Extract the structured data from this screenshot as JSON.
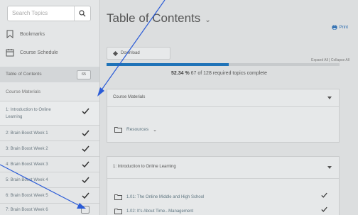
{
  "sidebar": {
    "search_placeholder": "Search Topics",
    "bookmarks": "Bookmarks",
    "course_schedule": "Course Schedule",
    "toc_label": "Table of Contents",
    "toc_count": "65",
    "materials_heading": "Course Materials",
    "modules": [
      {
        "label": "1: Introduction to Online Learning",
        "status": "complete"
      },
      {
        "label": "2: Brain Boost Week 1",
        "status": "complete"
      },
      {
        "label": "3: Brain Boost Week 2",
        "status": "complete"
      },
      {
        "label": "4: Brain Boost Week 3",
        "status": "complete"
      },
      {
        "label": "5: Brain Boost Week 4",
        "status": "complete"
      },
      {
        "label": "6: Brain Boost Week 5",
        "status": "complete"
      },
      {
        "label": "7: Brain Boost Week 6",
        "status": "incomplete"
      }
    ]
  },
  "main": {
    "title": "Table of Contents",
    "print_label": "Print",
    "download_label": "Download",
    "expand_collapse": "Expand All | Collapse All",
    "progress": {
      "percent_text": "52.34 %",
      "detail": "67 of 128 required topics complete",
      "fraction": 0.5234
    },
    "panel1": {
      "title": "Course Materials",
      "folder": "Resources"
    },
    "panel2": {
      "title": "1: Introduction to Online Learning",
      "topics": [
        {
          "label": "1.01: The Online Middle and High School",
          "status": "complete"
        },
        {
          "label": "1.02: It's About Time...Management",
          "status": "complete"
        }
      ]
    }
  },
  "colors": {
    "accent": "#1f73b8",
    "annotation_arrow": "#2a5bd7"
  }
}
